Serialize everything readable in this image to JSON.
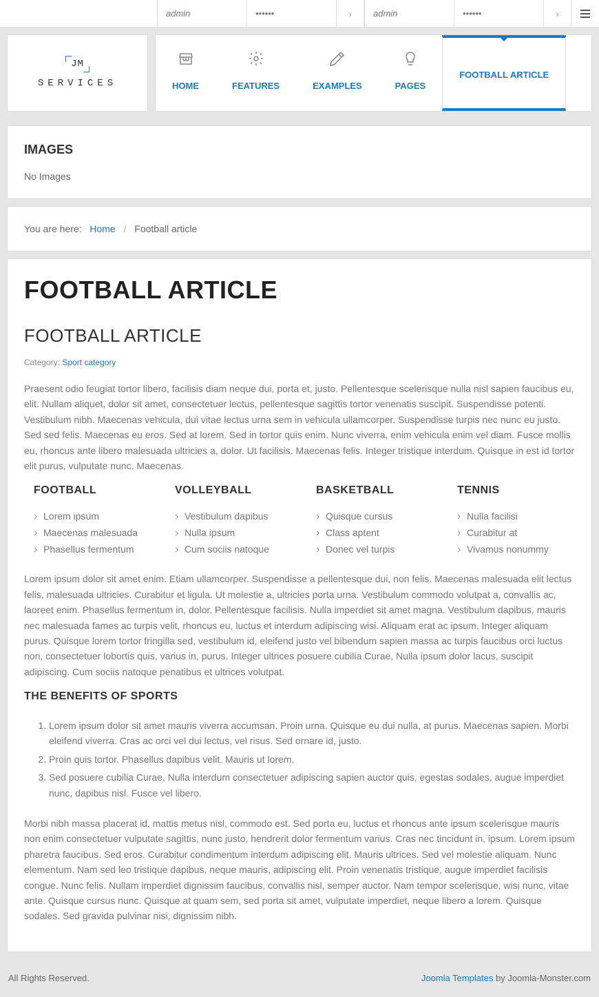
{
  "topbar": {
    "login1": {
      "user_placeholder": "admin",
      "pass_placeholder": "••••••"
    },
    "login2": {
      "user_placeholder": "admin",
      "pass_placeholder": "••••••"
    }
  },
  "logo": {
    "top": "JM",
    "bottom": "SERVICES"
  },
  "nav": [
    {
      "label": "HOME",
      "icon": "store"
    },
    {
      "label": "FEATURES",
      "icon": "gear"
    },
    {
      "label": "EXAMPLES",
      "icon": "pencil"
    },
    {
      "label": "PAGES",
      "icon": "bulb"
    },
    {
      "label": "FOOTBALL ARTICLE",
      "icon": "",
      "active": true
    }
  ],
  "images_panel": {
    "title": "IMAGES",
    "text": "No Images"
  },
  "breadcrumb": {
    "prefix": "You are here:",
    "home": "Home",
    "current": "Football article"
  },
  "article": {
    "h1": "FOOTBALL ARTICLE",
    "h2": "FOOTBALL ARTICLE",
    "category_label": "Category:",
    "category_link": "Sport category",
    "intro": "Praesent odio feugiat tortor libero, facilisis diam neque dui, porta et, justo. Pellentesque scelerisque nulla nisl sapien faucibus eu, elit. Nullam aliquet, dolor sit amet, consectetuer lectus, pellentesque sagittis tortor venenatis suscipit. Suspendisse potenti. Vestibulum nibh. Maecenas vehicula, dui vitae lectus urna sem in vehicula ullamcorper. Suspendisse turpis nec nunc eu justo. Sed sed felis. Maecenas eu eros. Sed at lorem. Sed in tortor quis enim. Nunc viverra, enim vehicula enim vel diam. Fusce mollis eu, rhoncus ante libero malesuada ultricies a, dolor. Ut facilisis. Maecenas felis. Integer tristique interdum. Quisque in est id tortor elit purus, vulputate nunc. Maecenas.",
    "sports": [
      {
        "name": "FOOTBALL",
        "items": [
          "Lorem ipsum",
          "Maecenas malesuada",
          "Phasellus fermentum"
        ]
      },
      {
        "name": "VOLLEYBALL",
        "items": [
          "Vestibulum dapibus",
          "Nulla ipsum",
          "Cum sociis natoque"
        ]
      },
      {
        "name": "BASKETBALL",
        "items": [
          "Quisque cursus",
          "Class aptent",
          "Donec vel turpis"
        ]
      },
      {
        "name": "TENNIS",
        "items": [
          "Nulla facilisi",
          "Curabitur at",
          "Vivamus nonummy"
        ]
      }
    ],
    "mid": "Lorem ipsum dolor sit amet enim. Etiam ullamcorper. Suspendisse a pellentesque dui, non felis. Maecenas malesuada elit lectus felis, malesuada ultricies. Curabitur et ligula. Ut molestie a, ultricies porta urna. Vestibulum commodo volutpat a, convallis ac, laoreet enim. Phasellus fermentum in, dolor. Pellentesque facilisis. Nulla imperdiet sit amet magna. Vestibulum dapibus, mauris nec malesuada fames ac turpis velit, rhoncus eu, luctus et interdum adipiscing wisi. Aliquam erat ac ipsum. Integer aliquam purus. Quisque lorem tortor fringilla sed, vestibulum id, eleifend justo vel bibendum sapien massa ac turpis faucibus orci luctus non, consectetuer lobortis quis, varius in, purus. Integer ultrices posuere cubilia Curae, Nulla ipsum dolor lacus, suscipit adipiscing. Cum sociis natoque penatibus et ultrices volutpat.",
    "benefits_title": "THE BENEFITS OF SPORTS",
    "benefits": [
      "Lorem ipsum dolor sit amet mauris viverra accumsan. Proin urna. Quisque eu dui nulla, at purus. Maecenas sapien. Morbi eleifend viverra. Cras ac orci vel dui lectus, vel risus. Sed ornare id, justo.",
      "Proin quis tortor. Phasellus dapibus velit. Mauris ut lorem.",
      "Sed posuere cubilia Curae, Nulla interdum consectetuer adipiscing sapien auctor quis, egestas sodales, augue imperdiet nunc, dapibus nisl. Fusce vel libero."
    ],
    "outro": "Morbi nibh massa placerat id, mattis metus nisl, commodo est. Sed porta eu, luctus et rhoncus ante ipsum scelerisque mauris non enim consectetuer vulputate sagittis, nunc justo, hendrerit dolor fermentum varius. Cras nec tincidunt in, ipsum. Lorem ipsum pharetra faucibus. Sed eros. Curabitur condimentum interdum adipiscing elit. Mauris ultrices. Sed vel molestie aliquam. Nunc elementum. Nam sed leo tristique dapibus, neque mauris, adipiscing elit. Proin venenatis tristique, augue imperdiet facilisis congue. Nunc felis. Nullam imperdiet dignissim faucibus, convallis nisl, semper auctor. Nam tempor scelerisque, wisi nunc, vitae ante. Quisque cursus nunc. Quisque at quam sem, sed porta sit amet, vulputate imperdiet, neque libero a lorem. Quisque sodales. Sed gravida pulvinar nisi, dignissim nibh."
  },
  "footer": {
    "left": "All Rights Reserved.",
    "link": "Joomla Templates",
    "suffix": " by Joomla-Monster.com"
  }
}
